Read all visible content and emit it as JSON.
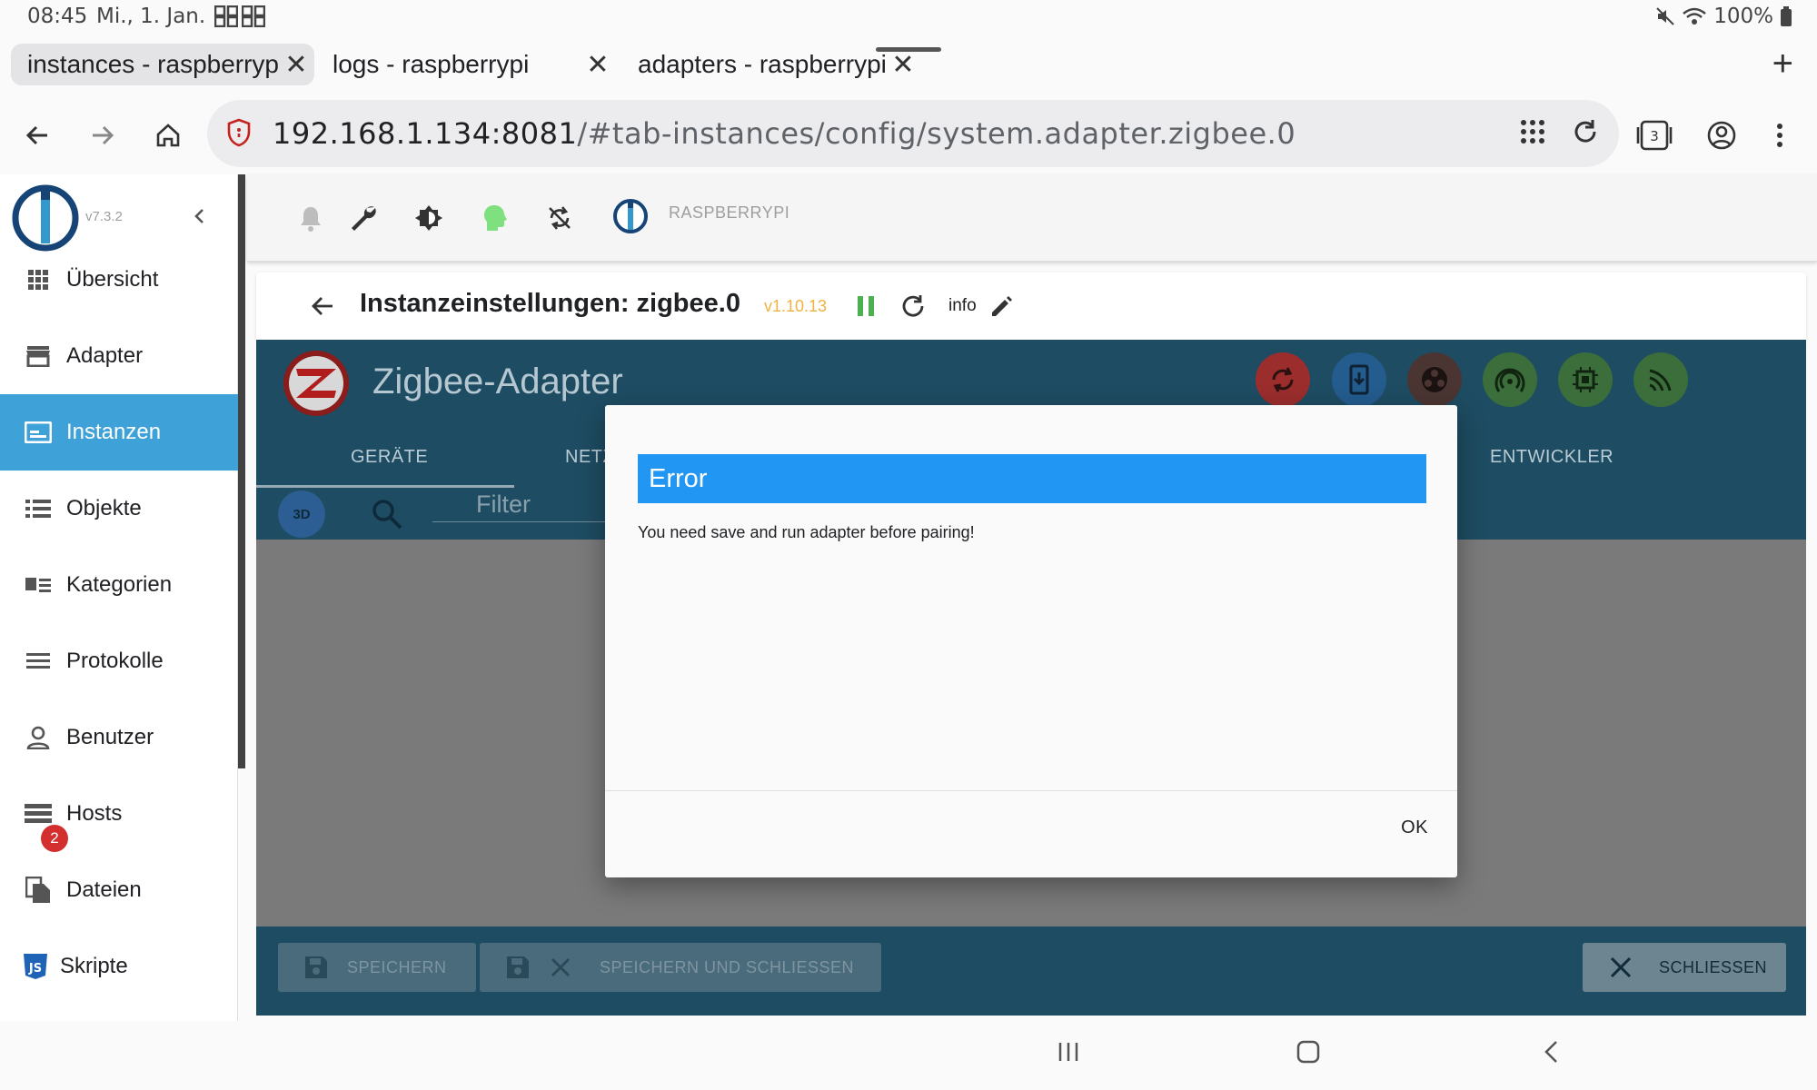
{
  "status_bar": {
    "time": "08:45",
    "date": "Mi., 1. Jan.",
    "battery": "100%"
  },
  "tabs": [
    {
      "label": "instances - raspberrypi",
      "active": true
    },
    {
      "label": "logs - raspberrypi",
      "active": false
    },
    {
      "label": "adapters - raspberrypi",
      "active": false
    }
  ],
  "address_bar": {
    "url_host": "192.168.1.134:8081",
    "url_path": "/#tab-instances/config/system.adapter.zigbee.0",
    "tab_count": "3"
  },
  "sidebar": {
    "version": "v7.3.2",
    "items": [
      {
        "label": "Übersicht",
        "icon": "grid-icon"
      },
      {
        "label": "Adapter",
        "icon": "store-icon"
      },
      {
        "label": "Instanzen",
        "icon": "instances-icon",
        "active": true
      },
      {
        "label": "Objekte",
        "icon": "list-icon"
      },
      {
        "label": "Kategorien",
        "icon": "categories-icon"
      },
      {
        "label": "Protokolle",
        "icon": "log-icon",
        "badge": "2"
      },
      {
        "label": "Benutzer",
        "icon": "user-icon"
      },
      {
        "label": "Hosts",
        "icon": "hosts-icon"
      },
      {
        "label": "Dateien",
        "icon": "files-icon"
      },
      {
        "label": "Skripte",
        "icon": "js-icon"
      }
    ]
  },
  "toolbar": {
    "hostname": "RASPBERRYPI"
  },
  "instance_header": {
    "title": "Instanzeinstellungen: zigbee.0",
    "version": "v1.10.13",
    "info_label": "info"
  },
  "adapter": {
    "title": "Zigbee-Adapter",
    "tabs": [
      "GERÄTE",
      "NETZ",
      "ENTWICKLER"
    ],
    "filter_placeholder": "Filter",
    "btn_3d": "3D",
    "header_buttons": [
      {
        "icon": "sync-icon",
        "color": "#9b2d2d"
      },
      {
        "icon": "download-device-icon",
        "color": "#245c8e"
      },
      {
        "icon": "group-icon",
        "color": "#4a3532"
      },
      {
        "icon": "wifi-tethering-icon",
        "color": "#3b6e3b"
      },
      {
        "icon": "memory-chip-icon",
        "color": "#3b6e3b"
      },
      {
        "icon": "signal-icon",
        "color": "#3b6e3b"
      }
    ]
  },
  "footer": {
    "save": "SPEICHERN",
    "save_close": "SPEICHERN UND SCHLIESSEN",
    "close": "SCHLIESSEN"
  },
  "dialog": {
    "title": "Error",
    "message": "You need save and run adapter before pairing!",
    "ok": "OK"
  },
  "colors": {
    "accent": "#2196f3",
    "sidebar_active": "#3ea2d8",
    "adapter_header": "#1e4c62",
    "version": "#f0b341"
  }
}
